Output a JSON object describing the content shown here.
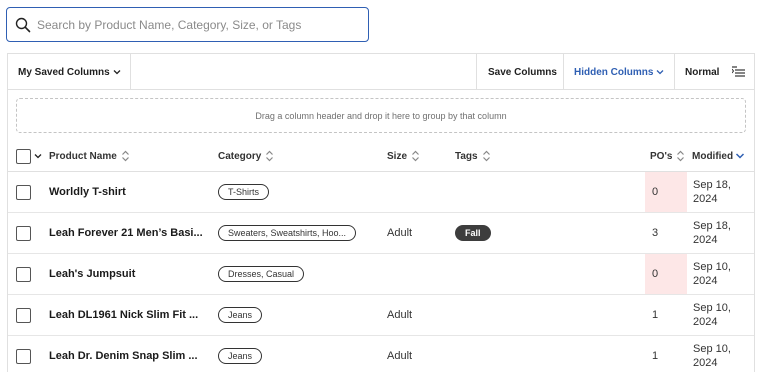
{
  "search": {
    "placeholder": "Search by Product Name, Category, Size, or Tags",
    "value": ""
  },
  "toolbar": {
    "saved_columns": "My Saved Columns",
    "save_columns": "Save Columns",
    "hidden_columns": "Hidden Columns",
    "density": "Normal",
    "accent_color": "#2f5fb3"
  },
  "dropzone": {
    "text": "Drag a column header and drop it here to group by that column"
  },
  "columns": {
    "product_name": "Product Name",
    "category": "Category",
    "size": "Size",
    "tags": "Tags",
    "pos": "PO's",
    "modified": "Modified"
  },
  "rows": [
    {
      "name": "Worldly T-shirt",
      "category": "T-Shirts",
      "size": "",
      "tag": "",
      "pos": "0",
      "modified": "Sep 18, 2024",
      "pos_zero": true
    },
    {
      "name": "Leah Forever 21 Men’s Basi...",
      "category": "Sweaters, Sweatshirts, Hoo...",
      "size": "Adult",
      "tag": "Fall",
      "pos": "3",
      "modified": "Sep 18, 2024",
      "pos_zero": false
    },
    {
      "name": "Leah's Jumpsuit",
      "category": "Dresses, Casual",
      "size": "",
      "tag": "",
      "pos": "0",
      "modified": "Sep 10, 2024",
      "pos_zero": true
    },
    {
      "name": "Leah DL1961 Nick Slim Fit ...",
      "category": "Jeans",
      "size": "Adult",
      "tag": "",
      "pos": "1",
      "modified": "Sep 10, 2024",
      "pos_zero": false
    },
    {
      "name": "Leah Dr. Denim Snap Slim ...",
      "category": "Jeans",
      "size": "Adult",
      "tag": "",
      "pos": "1",
      "modified": "Sep 10, 2024",
      "pos_zero": false
    }
  ]
}
